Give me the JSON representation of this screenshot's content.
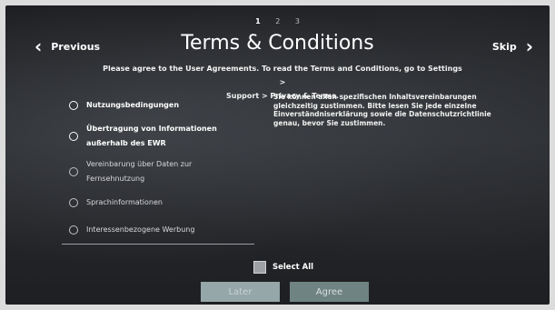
{
  "pager": {
    "pages": [
      "1",
      "2",
      "3"
    ],
    "active_index": 0
  },
  "nav": {
    "previous_label": "Previous",
    "skip_label": "Skip"
  },
  "title": "Terms & Conditions",
  "subtitle": {
    "line1": "Please agree to the User Agreements. To read the Terms and Conditions, go to Settings >",
    "line2": "Support > Privacy & Terms."
  },
  "options": [
    {
      "lines": [
        "Nutzungsbedingungen"
      ]
    },
    {
      "lines": [
        "Übertragung von Informationen",
        "außerhalb des EWR"
      ]
    },
    {
      "lines": [
        "Vereinbarung über Daten zur",
        "Fernsehnutzung"
      ]
    },
    {
      "lines": [
        "Sprachinformationen"
      ]
    },
    {
      "lines": [
        "Interessenbezogene Werbung"
      ]
    }
  ],
  "description": "Sie können allen spezifischen Inhaltsvereinbarungen gleichzeitig zustimmen. Bitte lesen Sie jede einzelne Einverständniserklärung sowie die Datenschutzrichtlinie genau, bevor Sie zustimmen.",
  "select_all_label": "Select All",
  "buttons": {
    "later": "Later",
    "agree": "Agree"
  }
}
